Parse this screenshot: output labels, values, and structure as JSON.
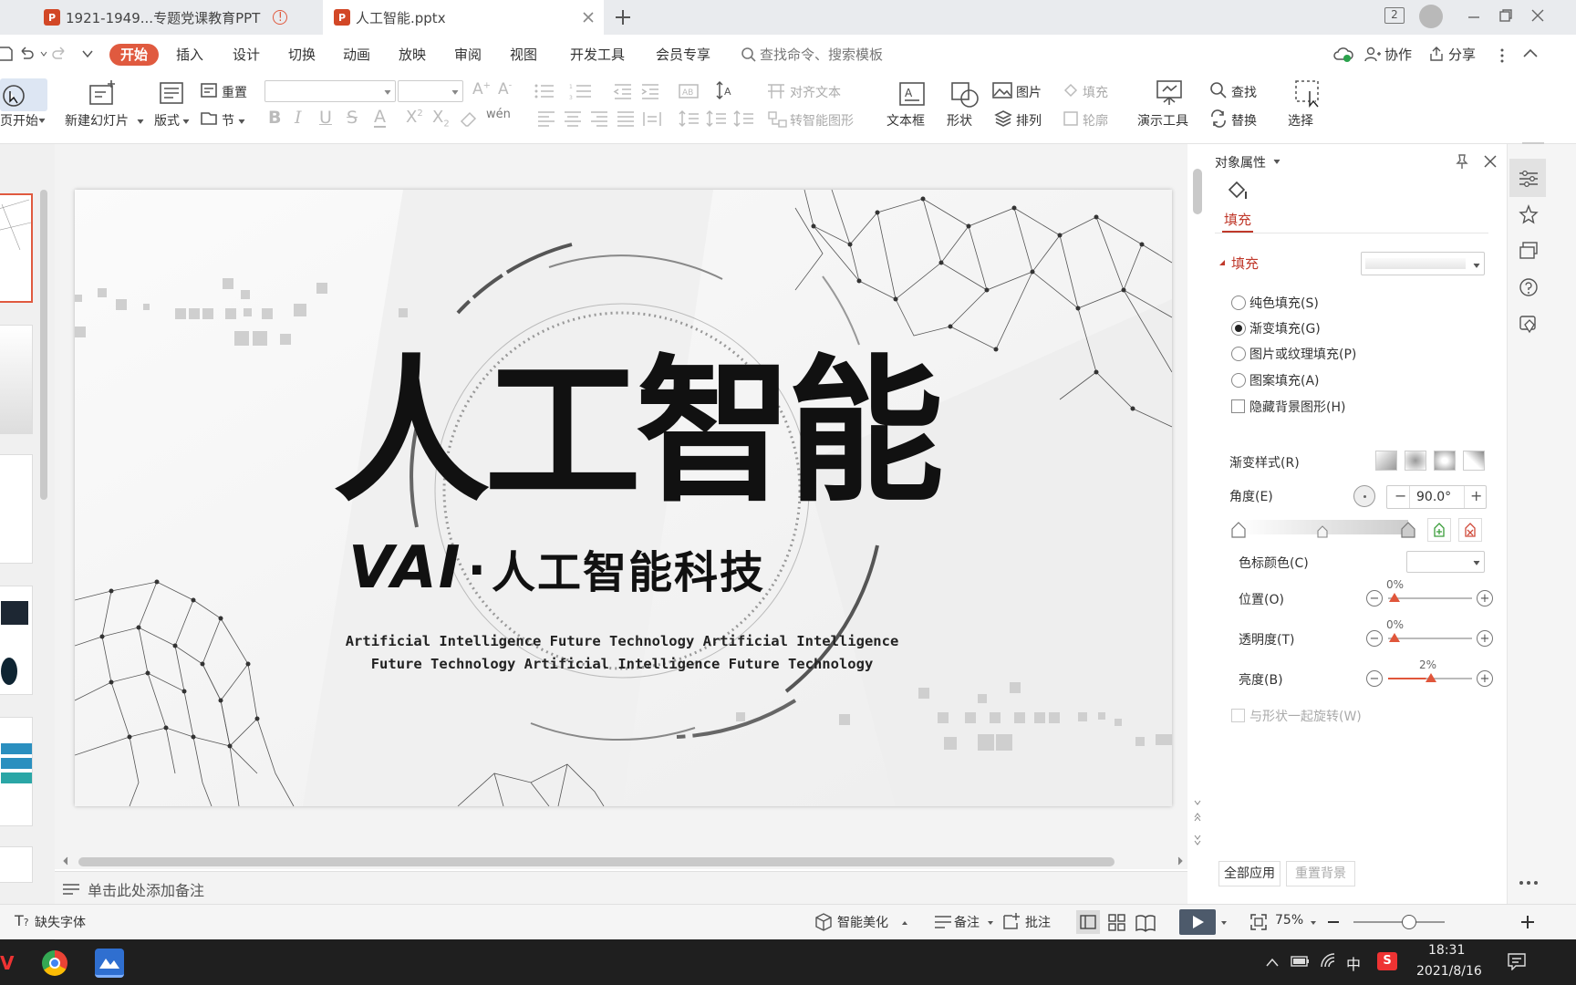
{
  "tabs": [
    {
      "title": "1921-1949...专题党课教育PPT",
      "active": false
    },
    {
      "title": "人工智能.pptx",
      "active": true
    }
  ],
  "window": {
    "badge": "2"
  },
  "menu": {
    "items": [
      "开始",
      "插入",
      "设计",
      "切换",
      "动画",
      "放映",
      "审阅",
      "视图",
      "开发工具",
      "会员专享"
    ],
    "search_placeholder": "查找命令、搜索模板",
    "collab": "协作",
    "share": "分享"
  },
  "ribbon": {
    "from_start": "页开始",
    "new_slide": "新建幻灯片",
    "layout": "版式",
    "reset": "重置",
    "section": "节",
    "align_text": "对齐文本",
    "to_smartart": "转智能图形",
    "textbox": "文本框",
    "shape": "形状",
    "picture": "图片",
    "arrange": "排列",
    "fill": "填充",
    "outline": "轮廓",
    "presenter_tools": "演示工具",
    "find": "查找",
    "replace": "替换",
    "select": "选择"
  },
  "slide": {
    "title": "人工智能",
    "subtitle_brand": "VAI",
    "subtitle_text": "人工智能科技",
    "line1": "Artificial Intelligence Future Technology Artificial Intelligence",
    "line2": "Future Technology Artificial Intelligence Future Technology"
  },
  "notes_placeholder": "单击此处添加备注",
  "panel": {
    "title": "对象属性",
    "tab_fill": "填充",
    "section_fill": "填充",
    "options": [
      {
        "label": "纯色填充(S)",
        "selected": false
      },
      {
        "label": "渐变填充(G)",
        "selected": true
      },
      {
        "label": "图片或纹理填充(P)",
        "selected": false
      },
      {
        "label": "图案填充(A)",
        "selected": false
      }
    ],
    "hide_bg": "隐藏背景图形(H)",
    "gradient_style": "渐变样式(R)",
    "angle_label": "角度(E)",
    "angle_value": "90.0°",
    "stop_color": "色标颜色(C)",
    "position_label": "位置(O)",
    "position_value": "0%",
    "transparency_label": "透明度(T)",
    "transparency_value": "0%",
    "brightness_label": "亮度(B)",
    "brightness_value": "2%",
    "rotate_with_shape": "与形状一起旋转(W)",
    "apply_all": "全部应用",
    "reset_bg": "重置背景"
  },
  "statusbar": {
    "missing_font": "缺失字体",
    "beautify": "智能美化",
    "notes": "备注",
    "comments": "批注",
    "zoom": "75%"
  },
  "taskbar": {
    "ime": "中",
    "time": "18:31",
    "date": "2021/8/16"
  },
  "colors": {
    "accent": "#e05a3f",
    "ppt": "#d24726",
    "slider_marker": "#e0563b"
  }
}
